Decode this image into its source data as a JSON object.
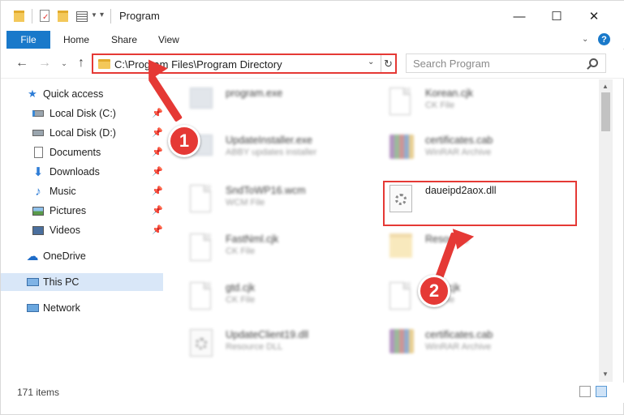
{
  "window": {
    "title": "Program",
    "controls": {
      "minimize": "—",
      "maximize": "☐",
      "close": "✕"
    }
  },
  "ribbon": {
    "tabs": [
      "File",
      "Home",
      "Share",
      "View"
    ],
    "help": "?"
  },
  "nav": {
    "address": "C:\\Program Files\\Program Directory",
    "search_placeholder": "Search Program"
  },
  "sidebar": {
    "items": [
      {
        "label": "Quick access",
        "icon": "star-icon",
        "pinned": false
      },
      {
        "label": "Local Disk (C:)",
        "icon": "drive-icon",
        "pinned": true
      },
      {
        "label": "Local Disk (D:)",
        "icon": "drive-icon",
        "pinned": true
      },
      {
        "label": "Documents",
        "icon": "documents-icon",
        "pinned": true
      },
      {
        "label": "Downloads",
        "icon": "download-icon",
        "pinned": true
      },
      {
        "label": "Music",
        "icon": "music-icon",
        "pinned": true
      },
      {
        "label": "Pictures",
        "icon": "pictures-icon",
        "pinned": true
      },
      {
        "label": "Videos",
        "icon": "videos-icon",
        "pinned": true
      },
      {
        "label": "OneDrive",
        "icon": "cloud-icon",
        "pinned": false
      },
      {
        "label": "This PC",
        "icon": "computer-icon",
        "pinned": false,
        "selected": true
      },
      {
        "label": "Network",
        "icon": "network-icon",
        "pinned": false
      }
    ]
  },
  "files": [
    {
      "name": "program.exe",
      "type": "",
      "icon": "exe-icon",
      "blurred": true
    },
    {
      "name": "Korean.cjk",
      "type": "CK File",
      "icon": "document-icon",
      "blurred": true
    },
    {
      "name": "UpdateInstaller.exe",
      "type": "ABBY updates installer",
      "icon": "exe-icon",
      "blurred": true
    },
    {
      "name": "certificates.cab",
      "type": "WinRAR Archive",
      "icon": "archive-icon",
      "blurred": true
    },
    {
      "name": "SndToWP16.wcm",
      "type": "WCM File",
      "icon": "document-icon",
      "blurred": true
    },
    {
      "name": "daueipd2aox.dll",
      "type": "",
      "icon": "dll-gear-icon",
      "blurred": false,
      "highlighted": true
    },
    {
      "name": "FastNml.cjk",
      "type": "CK File",
      "icon": "document-icon",
      "blurred": true
    },
    {
      "name": "Resource",
      "type": "",
      "icon": "folder-icon",
      "blurred": true
    },
    {
      "name": "gtd.cjk",
      "type": "CK File",
      "icon": "document-icon",
      "blurred": true
    },
    {
      "name": "...an.cjk",
      "type": "CK File",
      "icon": "document-icon",
      "blurred": true
    },
    {
      "name": "UpdateClient19.dll",
      "type": "Resource DLL",
      "icon": "dll-gear-icon",
      "blurred": true
    },
    {
      "name": "certificates.cab",
      "type": "WinRAR Archive",
      "icon": "archive-icon",
      "blurred": true
    }
  ],
  "status": {
    "item_count": "171 items"
  },
  "callouts": {
    "step1": "1",
    "step2": "2"
  },
  "colors": {
    "accent": "#1979ca",
    "annotation": "#e53935",
    "selected": "#d9e7f8"
  }
}
